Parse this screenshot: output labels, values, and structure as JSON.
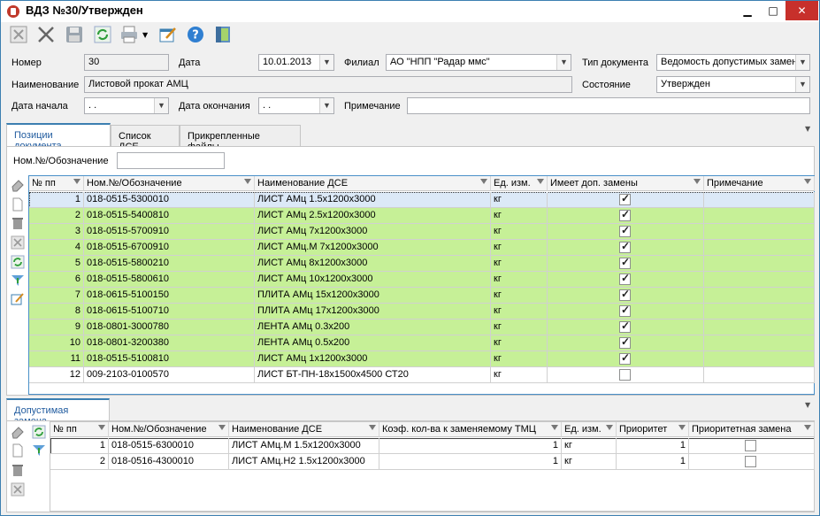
{
  "window": {
    "title": "ВДЗ №30/Утвержден",
    "minimize": "▁",
    "maximize": "□",
    "close": "✕"
  },
  "toolbar": {
    "icons": [
      "cancel-icon",
      "close-x-icon",
      "save-icon",
      "refresh-icon",
      "print-icon",
      "edit-icon",
      "help-icon",
      "exit-icon"
    ]
  },
  "form": {
    "number_label": "Номер",
    "number_value": "30",
    "date_label": "Дата",
    "date_value": "10.01.2013",
    "branch_label": "Филиал",
    "branch_value": "АО \"НПП \"Радар ммс\"",
    "doctype_label": "Тип документа",
    "doctype_value": "Ведомость допустимых замен",
    "name_label": "Наименование",
    "name_value": "Листовой прокат АМЦ",
    "state_label": "Состояние",
    "state_value": "Утвержден",
    "start_label": "Дата начала",
    "start_value": " .  .",
    "end_label": "Дата окончания",
    "end_value": " .  .",
    "note_label": "Примечание",
    "note_value": ""
  },
  "tabs": [
    "Позиции документа",
    "Список ДСЕ",
    "Прикрепленные файлы"
  ],
  "filter": {
    "label": "Ном.№/Обозначение",
    "value": ""
  },
  "grid": {
    "columns": [
      "№ пп",
      "Ном.№/Обозначение",
      "Наименование ДСЕ",
      "Ед. изм.",
      "Имеет доп. замены",
      "Примечание"
    ],
    "rows": [
      {
        "n": "1",
        "code": "018-0515-5300010",
        "name": "ЛИСТ АМц 1.5x1200x3000",
        "unit": "кг",
        "has": true
      },
      {
        "n": "2",
        "code": "018-0515-5400810",
        "name": "ЛИСТ АМц 2.5x1200x3000",
        "unit": "кг",
        "has": true
      },
      {
        "n": "3",
        "code": "018-0515-5700910",
        "name": "ЛИСТ АМц 7x1200x3000",
        "unit": "кг",
        "has": true
      },
      {
        "n": "4",
        "code": "018-0515-6700910",
        "name": "ЛИСТ АМц.М 7x1200x3000",
        "unit": "кг",
        "has": true
      },
      {
        "n": "5",
        "code": "018-0515-5800210",
        "name": "ЛИСТ АМц 8x1200x3000",
        "unit": "кг",
        "has": true
      },
      {
        "n": "6",
        "code": "018-0515-5800610",
        "name": "ЛИСТ АМц 10x1200x3000",
        "unit": "кг",
        "has": true
      },
      {
        "n": "7",
        "code": "018-0615-5100150",
        "name": "ПЛИТА АМц  15x1200x3000",
        "unit": "кг",
        "has": true
      },
      {
        "n": "8",
        "code": "018-0615-5100710",
        "name": "ПЛИТА АМц  17x1200x3000",
        "unit": "кг",
        "has": true
      },
      {
        "n": "9",
        "code": "018-0801-3000780",
        "name": "ЛЕНТА АМц 0.3x200",
        "unit": "кг",
        "has": true
      },
      {
        "n": "10",
        "code": "018-0801-3200380",
        "name": "ЛЕНТА АМц 0.5x200",
        "unit": "кг",
        "has": true
      },
      {
        "n": "11",
        "code": "018-0515-5100810",
        "name": "ЛИСТ АМц 1x1200x3000",
        "unit": "кг",
        "has": true
      },
      {
        "n": "12",
        "code": "009-2103-0100570",
        "name": "ЛИСТ БТ-ПН-18x1500x4500 СТ20",
        "unit": "кг",
        "has": false
      }
    ]
  },
  "bottom_tab": "Допустимая замена",
  "subgrid": {
    "columns": [
      "№ пп",
      "Ном.№/Обозначение",
      "Наименование ДСЕ",
      "Коэф. кол-ва к заменяемому ТМЦ",
      "Ед. изм.",
      "Приоритет",
      "Приоритетная замена"
    ],
    "rows": [
      {
        "n": "1",
        "code": "018-0515-6300010",
        "name": "ЛИСТ АМц.М 1.5x1200x3000",
        "coef": "1",
        "unit": "кг",
        "prio": "1",
        "pz": false
      },
      {
        "n": "2",
        "code": "018-0516-4300010",
        "name": "ЛИСТ АМц.Н2 1.5x1200x3000",
        "coef": "1",
        "unit": "кг",
        "prio": "1",
        "pz": false
      }
    ]
  },
  "colors": {
    "green": "#c6f097",
    "selected": "#dce9f7",
    "accent": "#3c7fb1"
  }
}
